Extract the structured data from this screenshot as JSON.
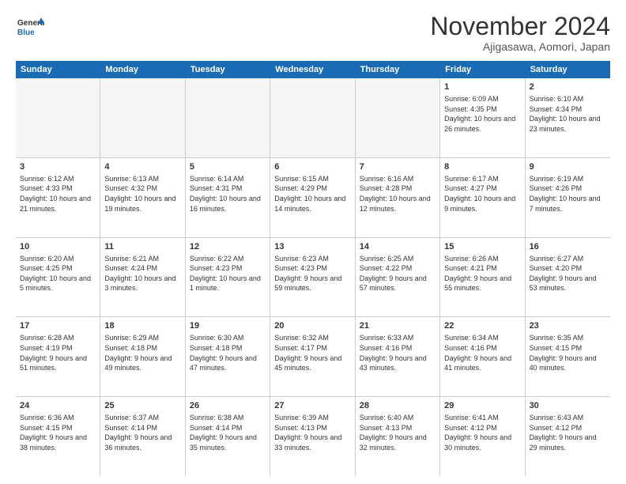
{
  "logo": {
    "line1": "General",
    "line2": "Blue"
  },
  "title": "November 2024",
  "location": "Ajigasawa, Aomori, Japan",
  "weekdays": [
    "Sunday",
    "Monday",
    "Tuesday",
    "Wednesday",
    "Thursday",
    "Friday",
    "Saturday"
  ],
  "rows": [
    [
      {
        "day": "",
        "info": "",
        "empty": true
      },
      {
        "day": "",
        "info": "",
        "empty": true
      },
      {
        "day": "",
        "info": "",
        "empty": true
      },
      {
        "day": "",
        "info": "",
        "empty": true
      },
      {
        "day": "",
        "info": "",
        "empty": true
      },
      {
        "day": "1",
        "info": "Sunrise: 6:09 AM\nSunset: 4:35 PM\nDaylight: 10 hours and 26 minutes."
      },
      {
        "day": "2",
        "info": "Sunrise: 6:10 AM\nSunset: 4:34 PM\nDaylight: 10 hours and 23 minutes."
      }
    ],
    [
      {
        "day": "3",
        "info": "Sunrise: 6:12 AM\nSunset: 4:33 PM\nDaylight: 10 hours and 21 minutes."
      },
      {
        "day": "4",
        "info": "Sunrise: 6:13 AM\nSunset: 4:32 PM\nDaylight: 10 hours and 19 minutes."
      },
      {
        "day": "5",
        "info": "Sunrise: 6:14 AM\nSunset: 4:31 PM\nDaylight: 10 hours and 16 minutes."
      },
      {
        "day": "6",
        "info": "Sunrise: 6:15 AM\nSunset: 4:29 PM\nDaylight: 10 hours and 14 minutes."
      },
      {
        "day": "7",
        "info": "Sunrise: 6:16 AM\nSunset: 4:28 PM\nDaylight: 10 hours and 12 minutes."
      },
      {
        "day": "8",
        "info": "Sunrise: 6:17 AM\nSunset: 4:27 PM\nDaylight: 10 hours and 9 minutes."
      },
      {
        "day": "9",
        "info": "Sunrise: 6:19 AM\nSunset: 4:26 PM\nDaylight: 10 hours and 7 minutes."
      }
    ],
    [
      {
        "day": "10",
        "info": "Sunrise: 6:20 AM\nSunset: 4:25 PM\nDaylight: 10 hours and 5 minutes."
      },
      {
        "day": "11",
        "info": "Sunrise: 6:21 AM\nSunset: 4:24 PM\nDaylight: 10 hours and 3 minutes."
      },
      {
        "day": "12",
        "info": "Sunrise: 6:22 AM\nSunset: 4:23 PM\nDaylight: 10 hours and 1 minute."
      },
      {
        "day": "13",
        "info": "Sunrise: 6:23 AM\nSunset: 4:23 PM\nDaylight: 9 hours and 59 minutes."
      },
      {
        "day": "14",
        "info": "Sunrise: 6:25 AM\nSunset: 4:22 PM\nDaylight: 9 hours and 57 minutes."
      },
      {
        "day": "15",
        "info": "Sunrise: 6:26 AM\nSunset: 4:21 PM\nDaylight: 9 hours and 55 minutes."
      },
      {
        "day": "16",
        "info": "Sunrise: 6:27 AM\nSunset: 4:20 PM\nDaylight: 9 hours and 53 minutes."
      }
    ],
    [
      {
        "day": "17",
        "info": "Sunrise: 6:28 AM\nSunset: 4:19 PM\nDaylight: 9 hours and 51 minutes."
      },
      {
        "day": "18",
        "info": "Sunrise: 6:29 AM\nSunset: 4:18 PM\nDaylight: 9 hours and 49 minutes."
      },
      {
        "day": "19",
        "info": "Sunrise: 6:30 AM\nSunset: 4:18 PM\nDaylight: 9 hours and 47 minutes."
      },
      {
        "day": "20",
        "info": "Sunrise: 6:32 AM\nSunset: 4:17 PM\nDaylight: 9 hours and 45 minutes."
      },
      {
        "day": "21",
        "info": "Sunrise: 6:33 AM\nSunset: 4:16 PM\nDaylight: 9 hours and 43 minutes."
      },
      {
        "day": "22",
        "info": "Sunrise: 6:34 AM\nSunset: 4:16 PM\nDaylight: 9 hours and 41 minutes."
      },
      {
        "day": "23",
        "info": "Sunrise: 6:35 AM\nSunset: 4:15 PM\nDaylight: 9 hours and 40 minutes."
      }
    ],
    [
      {
        "day": "24",
        "info": "Sunrise: 6:36 AM\nSunset: 4:15 PM\nDaylight: 9 hours and 38 minutes."
      },
      {
        "day": "25",
        "info": "Sunrise: 6:37 AM\nSunset: 4:14 PM\nDaylight: 9 hours and 36 minutes."
      },
      {
        "day": "26",
        "info": "Sunrise: 6:38 AM\nSunset: 4:14 PM\nDaylight: 9 hours and 35 minutes."
      },
      {
        "day": "27",
        "info": "Sunrise: 6:39 AM\nSunset: 4:13 PM\nDaylight: 9 hours and 33 minutes."
      },
      {
        "day": "28",
        "info": "Sunrise: 6:40 AM\nSunset: 4:13 PM\nDaylight: 9 hours and 32 minutes."
      },
      {
        "day": "29",
        "info": "Sunrise: 6:41 AM\nSunset: 4:12 PM\nDaylight: 9 hours and 30 minutes."
      },
      {
        "day": "30",
        "info": "Sunrise: 6:43 AM\nSunset: 4:12 PM\nDaylight: 9 hours and 29 minutes."
      }
    ]
  ]
}
